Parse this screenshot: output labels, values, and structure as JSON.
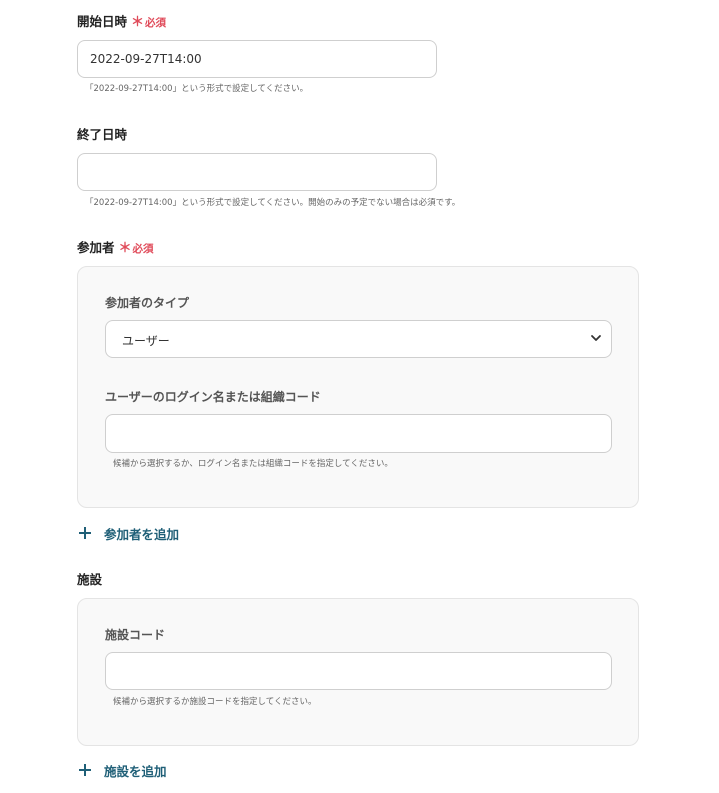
{
  "start_datetime": {
    "label": "開始日時",
    "required_mark": "＊",
    "required_text": "必須",
    "value": "2022-09-27T14:00",
    "help": "「2022-09-27T14:00」という形式で設定してください。"
  },
  "end_datetime": {
    "label": "終了日時",
    "value": "",
    "help": "「2022-09-27T14:00」という形式で設定してください。開始のみの予定でない場合は必須です。"
  },
  "participants": {
    "label": "参加者",
    "required_mark": "＊",
    "required_text": "必須",
    "type_label": "参加者のタイプ",
    "type_selected": "ユーザー",
    "login_label": "ユーザーのログイン名または組織コード",
    "login_value": "",
    "login_help": "候補から選択するか、ログイン名または組織コードを指定してください。",
    "add_label": "参加者を追加",
    "chevron_icon": "chevron-down-icon",
    "add_icon": "plus-icon"
  },
  "facilities": {
    "label": "施設",
    "code_label": "施設コード",
    "code_value": "",
    "code_help": "候補から選択するか施設コードを指定してください。",
    "add_label": "施設を追加",
    "add_icon": "plus-icon"
  },
  "colors": {
    "required": "#e04b5a",
    "link": "#1f5f77",
    "box_background": "#f9f9f9",
    "border": "#cfcfcf"
  }
}
